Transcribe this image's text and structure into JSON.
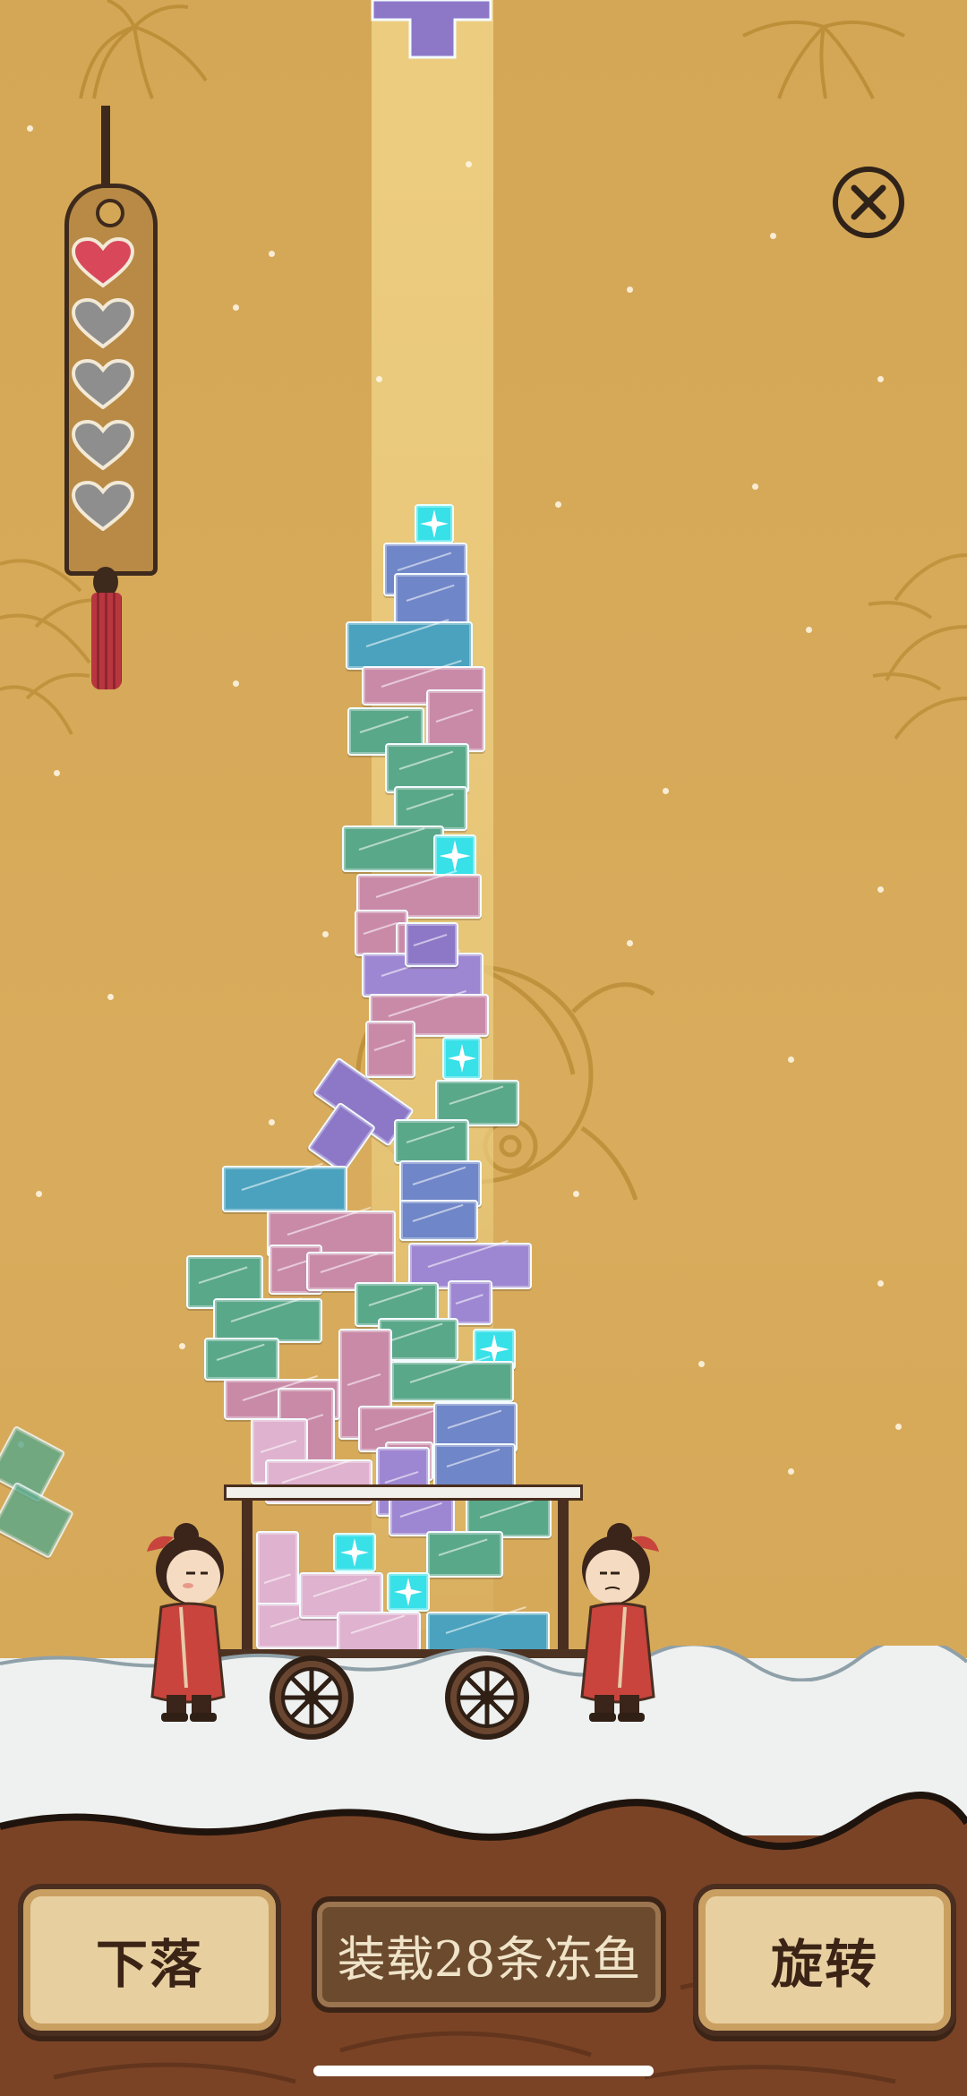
{
  "game": {
    "lives_total": 5,
    "lives_remaining": 1,
    "objective": "装载28条冻鱼",
    "drop_label": "下落",
    "rotate_label": "旋转"
  },
  "colors": {
    "background": "#d6a95a",
    "heart_full": "#d9475a",
    "heart_empty": "#8e8e8e",
    "ice_pink": "#c98aa8",
    "ice_green": "#5aa88a",
    "ice_blue": "#6f86c8",
    "ice_purple": "#8d78c8",
    "ice_cyan_spark": "#38e0e8",
    "porter_red": "#c8443d"
  },
  "icons": {
    "close": "close-circle-icon",
    "heart": "heart-icon"
  }
}
